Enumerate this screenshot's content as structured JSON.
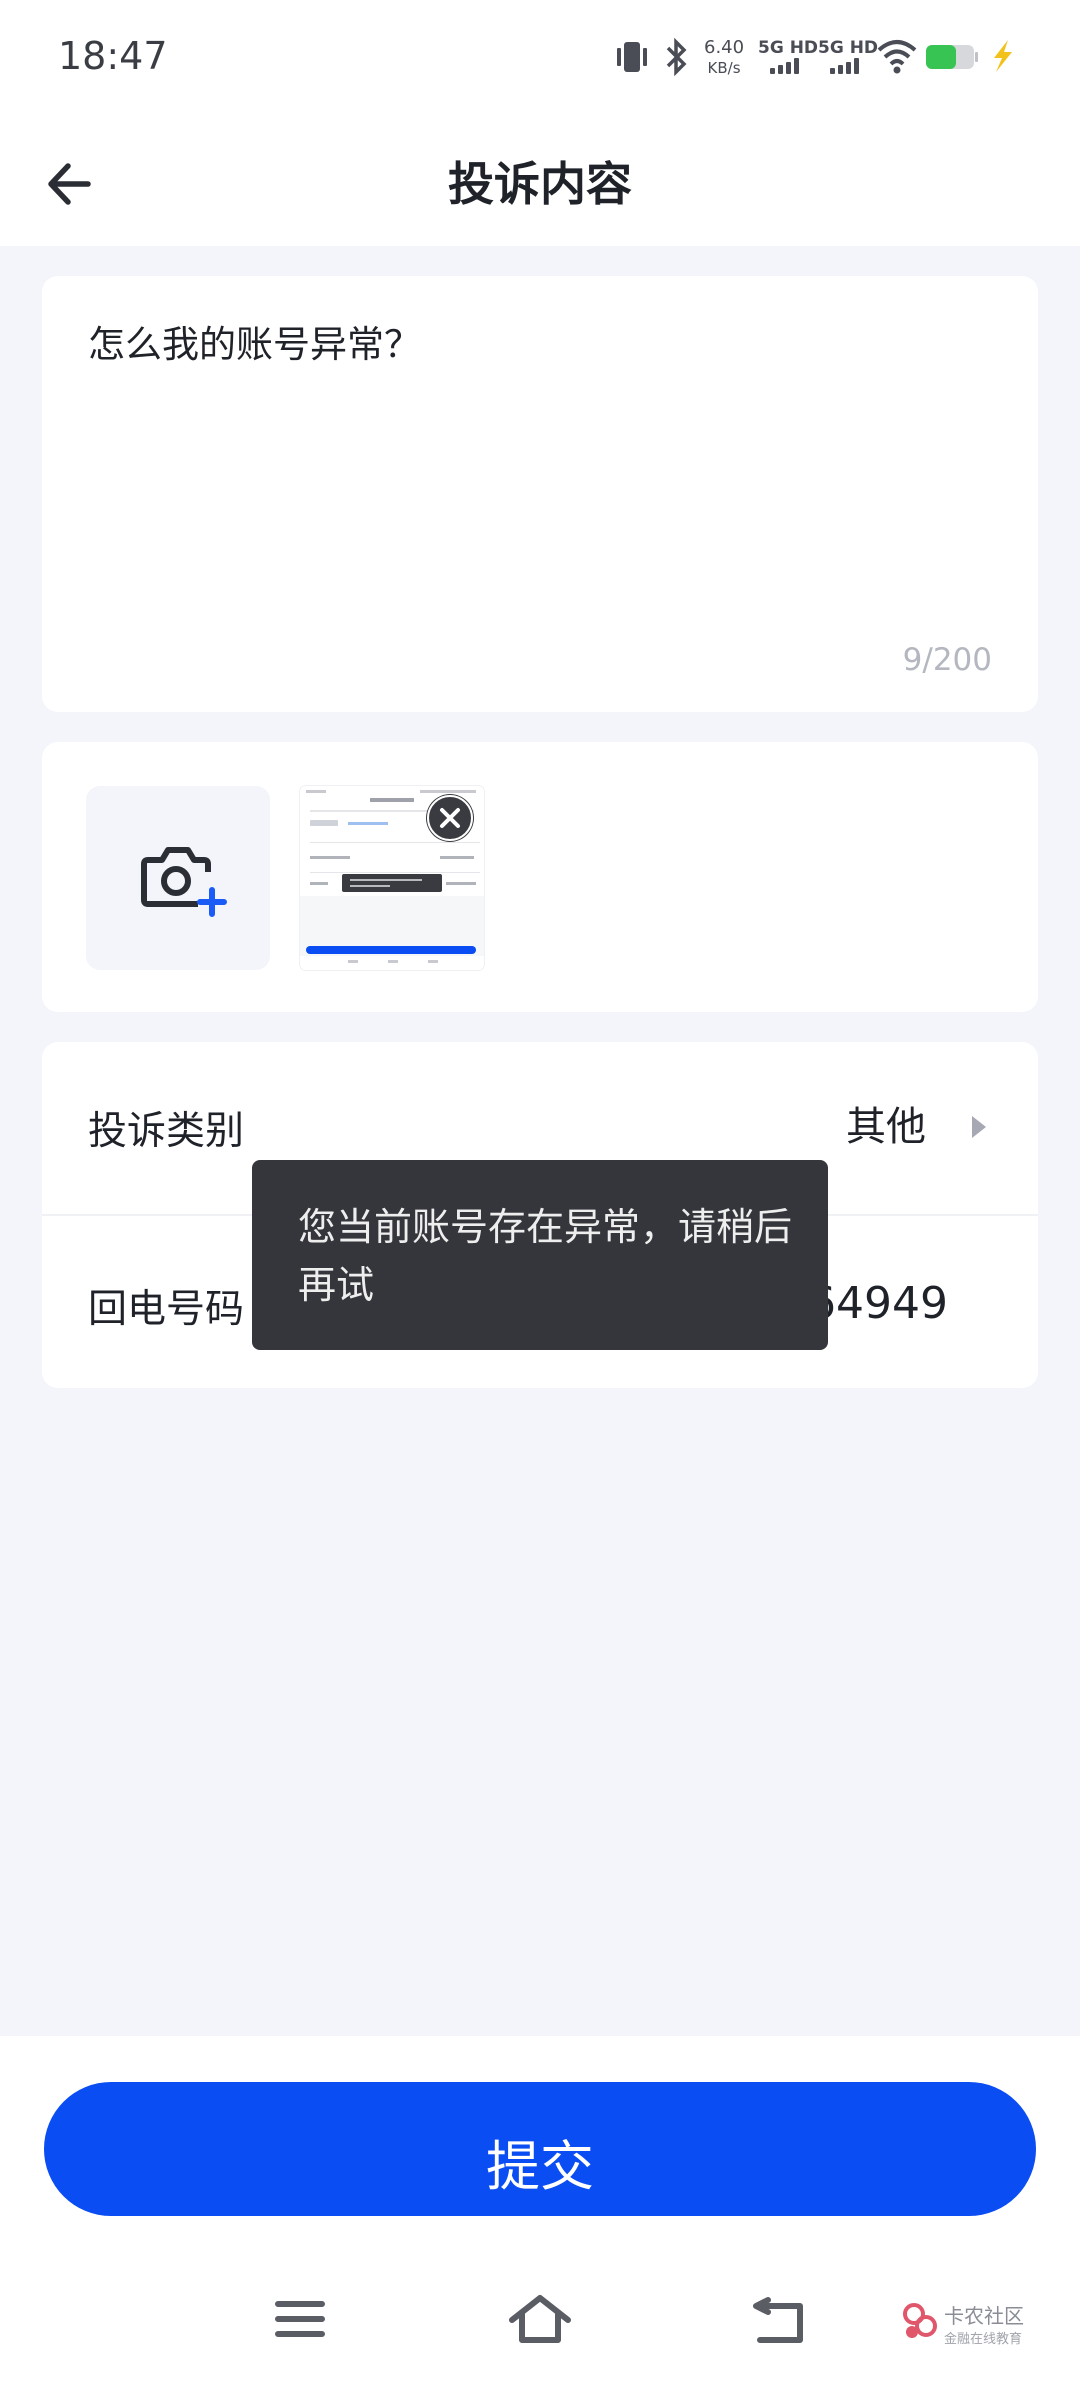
{
  "status_bar": {
    "time": "18:47",
    "net_speed_value": "6.40",
    "net_speed_unit": "KB/s",
    "sim1_label": "5G HD",
    "sim2_label": "5G HD",
    "icons": [
      "vibrate-icon",
      "bluetooth-icon",
      "signal-icon",
      "wifi-icon",
      "battery-icon",
      "charging-icon"
    ]
  },
  "header": {
    "title": "投诉内容",
    "back_icon": "arrow-left-icon"
  },
  "complaint": {
    "text": "怎么我的账号异常？",
    "char_count": "9/200"
  },
  "images": {
    "add_icon": "camera-add-icon",
    "remove_icon": "close-icon"
  },
  "form": {
    "category_label": "投诉类别",
    "category_value": "其他",
    "phone_label": "回电号码",
    "phone_value": "13567664949"
  },
  "toast": {
    "message": "您当前账号存在异常，请稍后再试"
  },
  "submit": {
    "label": "提交"
  },
  "nav": {
    "icons": [
      "menu-icon",
      "home-icon",
      "back-icon"
    ]
  },
  "watermark": {
    "title": "卡农社区",
    "subtitle": "金融在线教育"
  },
  "colors": {
    "accent": "#0a4df3",
    "page_bg": "#f3f5fa",
    "toast_bg": "#35363b"
  }
}
